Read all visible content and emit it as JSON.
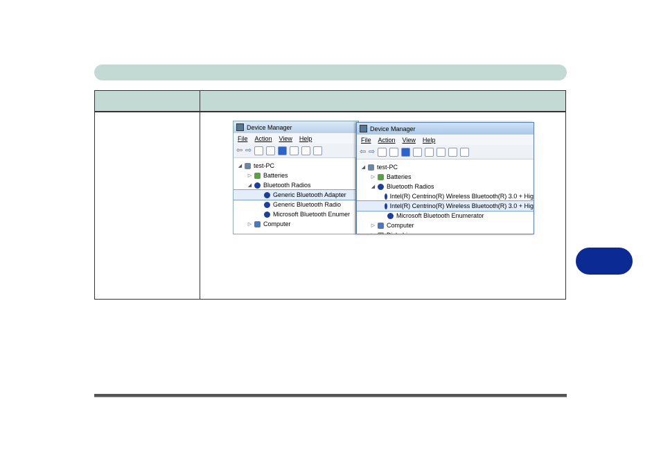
{
  "left_window": {
    "title": "Device Manager",
    "menu": [
      "File",
      "Action",
      "View",
      "Help"
    ],
    "tree": [
      {
        "label": "test-PC",
        "indent": 0,
        "expander": "◢",
        "icon": "pc"
      },
      {
        "label": "Batteries",
        "indent": 1,
        "expander": "▷",
        "icon": "bat"
      },
      {
        "label": "Bluetooth Radios",
        "indent": 1,
        "expander": "◢",
        "icon": "bt"
      },
      {
        "label": "Generic Bluetooth Adapter",
        "indent": 2,
        "expander": "",
        "icon": "bt",
        "selected": true
      },
      {
        "label": "Generic Bluetooth Radio",
        "indent": 2,
        "expander": "",
        "icon": "bt"
      },
      {
        "label": "Microsoft Bluetooth Enumer",
        "indent": 2,
        "expander": "",
        "icon": "bt"
      },
      {
        "label": "Computer",
        "indent": 1,
        "expander": "▷",
        "icon": "comp"
      }
    ]
  },
  "right_window": {
    "title": "Device Manager",
    "menu": [
      "File",
      "Action",
      "View",
      "Help"
    ],
    "tree": [
      {
        "label": "test-PC",
        "indent": 0,
        "expander": "◢",
        "icon": "pc"
      },
      {
        "label": "Batteries",
        "indent": 1,
        "expander": "▷",
        "icon": "bat"
      },
      {
        "label": "Bluetooth Radios",
        "indent": 1,
        "expander": "◢",
        "icon": "bt"
      },
      {
        "label": "Intel(R) Centrino(R) Wireless Bluetooth(R) 3.0 + Hig",
        "indent": 2,
        "expander": "",
        "icon": "bt"
      },
      {
        "label": "Intel(R) Centrino(R) Wireless Bluetooth(R) 3.0 + Hig",
        "indent": 2,
        "expander": "",
        "icon": "bt",
        "selected": true
      },
      {
        "label": "Microsoft Bluetooth Enumerator",
        "indent": 2,
        "expander": "",
        "icon": "bt"
      },
      {
        "label": "Computer",
        "indent": 1,
        "expander": "▷",
        "icon": "comp"
      },
      {
        "label": "Disk drives",
        "indent": 1,
        "expander": "▷",
        "icon": "disk"
      }
    ]
  }
}
